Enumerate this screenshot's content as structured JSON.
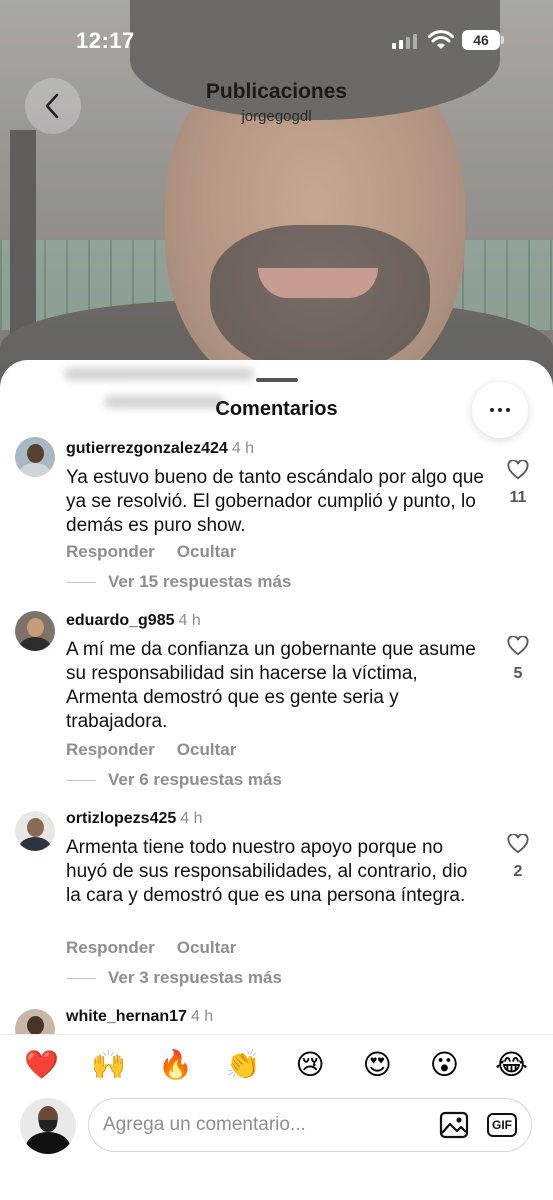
{
  "status_bar": {
    "time": "12:17",
    "battery": "46"
  },
  "header": {
    "title": "Publicaciones",
    "subtitle": "jorgegogdl"
  },
  "sheet": {
    "title": "Comentarios"
  },
  "comments": [
    {
      "username": "gutierrezgonzalez424",
      "time_ago": "4 h",
      "text": "Ya estuvo bueno de tanto escándalo por algo que ya se resolvió. El gobernador cumplió y punto, lo demás es puro show.",
      "likes": "11",
      "reply_label": "Responder",
      "hide_label": "Ocultar",
      "more_replies": "Ver 15 respuestas más"
    },
    {
      "username": "eduardo_g985",
      "time_ago": "4 h",
      "text": "A mí me da confianza un gobernante que asume su responsabilidad sin hacerse la víctima, Armenta demostró que es gente seria y trabajadora.",
      "likes": "5",
      "reply_label": "Responder",
      "hide_label": "Ocultar",
      "more_replies": "Ver 6 respuestas más"
    },
    {
      "username": "ortizlopezs425",
      "time_ago": "4 h",
      "text": "Armenta tiene todo nuestro apoyo porque no huyó de sus responsabilidades, al contrario, dio la cara y demostró que es una persona íntegra.",
      "likes": "2",
      "reply_label": "Responder",
      "hide_label": "Ocultar",
      "more_replies": "Ver 3 respuestas más"
    },
    {
      "username": "white_hernan17",
      "time_ago": "4 h"
    }
  ],
  "emoji_reactions": [
    "❤️",
    "🙌",
    "🔥",
    "👏",
    "😢",
    "😍",
    "😮",
    "😂"
  ],
  "composer": {
    "placeholder": "Agrega un comentario...",
    "gif_label": "GIF"
  },
  "colors": {
    "like_count": "#555555",
    "muted": "#8e8e8e",
    "heart_red": "#e0282e"
  }
}
